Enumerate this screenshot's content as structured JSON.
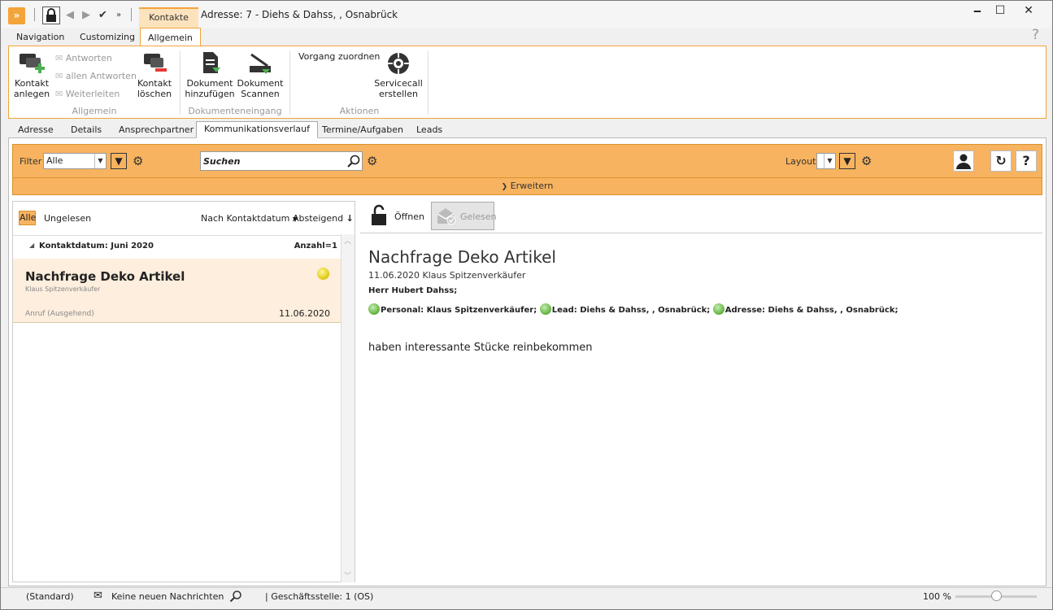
{
  "titlebar": {
    "context_tab": "Kontakte",
    "window_title": "Adresse: 7 - Diehs & Dahss, , Osnabrück",
    "minimize": "🗕",
    "maximize": "☐",
    "close": "✕"
  },
  "ribbon_tabs": [
    "Navigation",
    "Customizing",
    "Allgemein"
  ],
  "help_mark": "?",
  "ribbon": {
    "kontakt_anlegen": "Kontakt anlegen",
    "antworten": "Antworten",
    "allen_antworten": "allen Antworten",
    "weiterleiten": "Weiterleiten",
    "kontakt_loeschen": "Kontakt löschen",
    "group_allgemein": "Allgemein",
    "dokument_hinzufuegen": "Dokument hinzufügen",
    "dokument_scannen": "Dokument Scannen",
    "group_dokumenteneingang": "Dokumenteneingang",
    "vorgang_zuordnen": "Vorgang zuordnen",
    "servicecall_erstellen": "Servicecall erstellen",
    "group_aktionen": "Aktionen"
  },
  "sub_tabs": [
    "Adresse",
    "Details",
    "Ansprechpartner",
    "Kommunikationsverlauf",
    "Termine/Aufgaben",
    "Leads"
  ],
  "filterbar": {
    "filter_label": "Filter",
    "filter_value": "Alle",
    "search_value": "Suchen",
    "layout_label": "Layout",
    "expand_label": "Erweitern"
  },
  "list": {
    "tab_all": "Alle",
    "tab_unread": "Ungelesen",
    "sort_by": "Nach Kontaktdatum",
    "sort_dir": "Absteigend",
    "group_label": "Kontaktdatum: Juni 2020",
    "group_count": "Anzahl=1",
    "items": [
      {
        "title": "Nachfrage Deko Artikel",
        "person": "Klaus Spitzenverkäufer",
        "type": "Anruf (Ausgehend)",
        "date": "11.06.2020"
      }
    ]
  },
  "detail": {
    "open_label": "Öffnen",
    "read_label": "Gelesen",
    "title": "Nachfrage Deko Artikel",
    "meta": "11.06.2020 Klaus Spitzenverkäufer",
    "salutation": "Herr Hubert Dahss;",
    "personal": "Personal:  Klaus Spitzenverkäufer;",
    "lead": "Lead:  Diehs & Dahss, , Osnabrück;",
    "adresse": "Adresse:  Diehs & Dahss, , Osnabrück;",
    "body": "haben interessante Stücke reinbekommen"
  },
  "statusbar": {
    "standard": "(Standard)",
    "messages": "Keine neuen Nachrichten",
    "branch": "| Geschäftsstelle:  1 (OS)",
    "zoom": "100 %"
  },
  "zoom_level": 0.44,
  "colors": {
    "accent": "#f7b35f",
    "accent_border": "#d8922e",
    "card_bg": "#fdeedd"
  }
}
